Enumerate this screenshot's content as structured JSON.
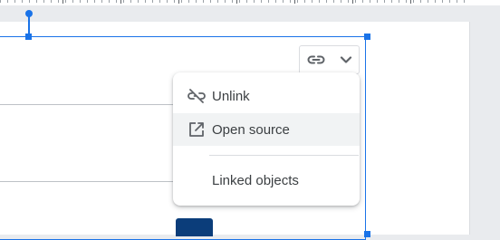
{
  "link_toolbar": {
    "link_icon": "link-icon",
    "dropdown_icon": "chevron-down-icon"
  },
  "context_menu": {
    "items": [
      {
        "label": "Unlink",
        "icon": "link-off-icon"
      },
      {
        "label": "Open source",
        "icon": "open-in-new-icon"
      },
      {
        "label": "Linked objects",
        "icon": ""
      }
    ]
  },
  "colors": {
    "selection": "#1a73e8",
    "hover_background": "#f1f3f4",
    "menu_text": "#3c4043",
    "thumbnail": "#0b3d7a"
  }
}
